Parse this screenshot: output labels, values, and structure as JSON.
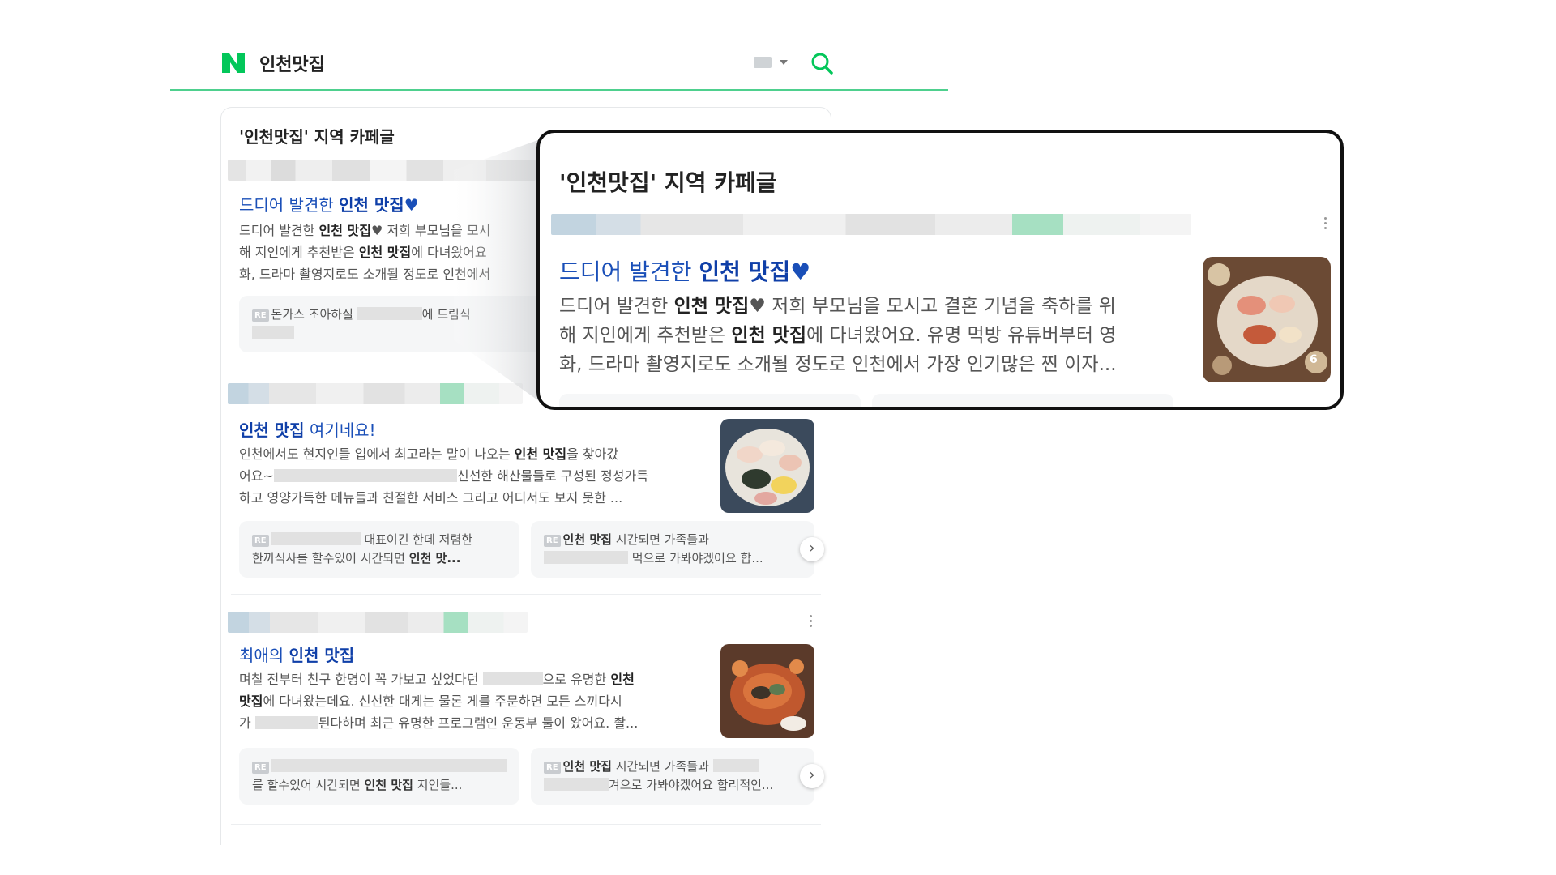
{
  "search": {
    "query": "인천맛집",
    "logo_letter": "N",
    "brand_color": "#03c75a",
    "icons": [
      "keyboard-icon",
      "chevron-down-icon",
      "search-icon"
    ]
  },
  "section": {
    "title": "'인천맛집' 지역 카페글"
  },
  "posts": [
    {
      "title_pre": "드디어 발견한 ",
      "title_bold": "인천 맛집",
      "title_suffix": "♥",
      "desc_line1_pre": "드디어 발견한 ",
      "desc_line1_bold": "인천 맛집",
      "desc_line1_post": "♥ 저희 부모님을 모시",
      "desc_line2_pre": "해 지인에게 추천받은 ",
      "desc_line2_bold": "인천 맛집",
      "desc_line2_post": "에 다녀왔어요",
      "desc_line3": "화, 드라마 촬영지로도 소개될 정도로 인천에서",
      "reply1_pre": "돈가스 조아하실 ",
      "reply1_post": "에 드림식"
    },
    {
      "title_bold": "인천 맛집",
      "title_post": " 여기네요!",
      "desc_line1_pre": "인천에서도 현지인들 입에서 최고라는 말이 나오는 ",
      "desc_line1_bold": "인천 맛집",
      "desc_line1_post": "을 찾아갔",
      "desc_line2_pre": "어요~",
      "desc_line2_post": "신선한 해산물들로 구성된 정성가득",
      "desc_line3": "하고 영양가득한 메뉴들과 친절한 서비스 그리고 어디서도 보지 못한 ...",
      "reply1_line1": "대표이긴 한데 저렴한",
      "reply1_line2_pre": "한끼식사를 할수있어 시간되면 ",
      "reply1_line2_bold": "인천 맛...",
      "reply2_line1_bold": "인천 맛집",
      "reply2_line1_post": " 시간되면 가족들과",
      "reply2_line2": "먹으로 가봐야겠어요 합..."
    },
    {
      "title_pre": "최애의 ",
      "title_bold": "인천 맛집",
      "desc_line1_pre": "며칠 전부터 친구 한명이 꼭 가보고 싶었다던 ",
      "desc_line1_post": "으로 유명한 ",
      "desc_line1_bold": "인천",
      "desc_line2_bold": "맛집",
      "desc_line2_post": "에 다녀왔는데요. 신선한 대게는 물론 게를 주문하면 모든 스끼다시",
      "desc_line3_pre": "가 ",
      "desc_line3_post": "된다하며 최근 유명한 프로그램인 운동부 둘이 왔어요. 촬...",
      "reply1_line2_pre": "를 할수있어 시간되면 ",
      "reply1_line2_bold": "인천 맛집",
      "reply1_line2_post": " 지인들...",
      "reply2_line1_bold": "인천 맛집",
      "reply2_line1_post": " 시간되면 가족들과",
      "reply2_line2": "겨으로 가봐야겠어요 합리적인..."
    }
  ],
  "zoom": {
    "title": "'인천맛집' 지역 카페글",
    "post_title_pre": "드디어 발견한 ",
    "post_title_bold": "인천 맛집",
    "post_title_suffix": "♥",
    "line1_pre": "드디어 발견한 ",
    "line1_bold": "인천 맛집",
    "line1_post": "♥ 저희 부모님을 모시고 결혼 기념을 축하를 위",
    "line2_pre": "해 지인에게 추천받은 ",
    "line2_bold": "인천 맛집",
    "line2_post": "에 다녀왔어요. 유명 먹방 유튜버부터 영",
    "line3": "화, 드라마 촬영지로도 소개될 정도로 인천에서 가장 인기많은 찐 이자...",
    "image_count": "6"
  },
  "labels": {
    "reply_badge": "RE",
    "next": "›"
  }
}
